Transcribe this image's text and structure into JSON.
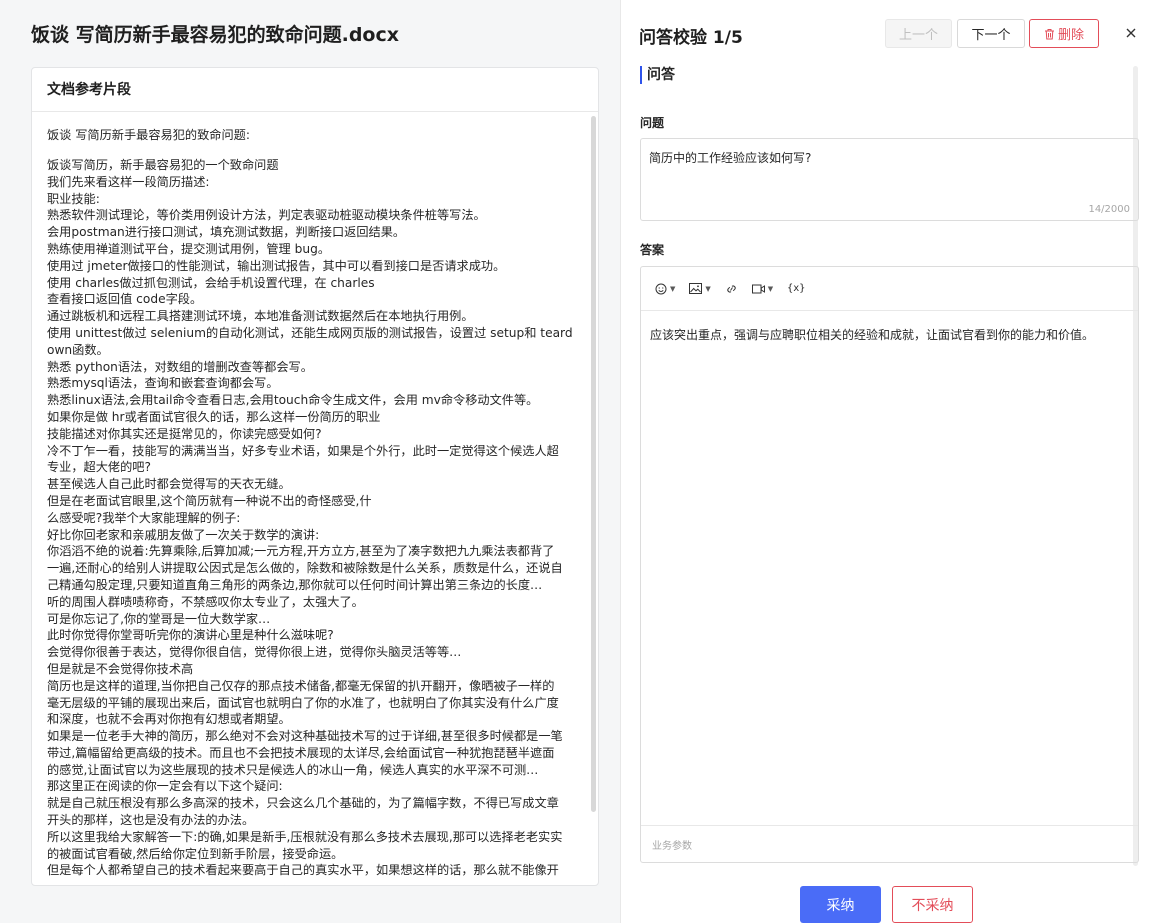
{
  "document": {
    "title": "饭谈 写简历新手最容易犯的致命问题.docx",
    "reference_header": "文档参考片段",
    "reference_first_line": "饭谈 写简历新手最容易犯的致命问题:",
    "reference_lines": [
      "饭谈写简历，新手最容易犯的一个致命问题",
      "我们先来看这样一段简历描述:",
      "职业技能:",
      "熟悉软件测试理论，等价类用例设计方法，判定表驱动桩驱动模块条件桩等写法。",
      "会用postman进行接口测试，填充测试数据，判断接口返回结果。",
      "熟练使用禅道测试平台，提交测试用例，管理 bug。",
      "使用过 jmeter做接口的性能测试，输出测试报告，其中可以看到接口是否请求成功。",
      "使用 charles做过抓包测试，会给手机设置代理，在 charles",
      "查看接口返回值 code字段。",
      "通过跳板机和远程工具搭建测试环境，本地准备测试数据然后在本地执行用例。",
      "使用 unittest做过 selenium的自动化测试，还能生成网页版的测试报告，设置过 setup和 teard",
      "own函数。",
      "熟悉 python语法，对数组的增删改查等都会写。",
      "熟悉mysql语法，查询和嵌套查询都会写。",
      "熟悉linux语法,会用tail命令查看日志,会用touch命令生成文件，会用 mv命令移动文件等。",
      "如果你是做 hr或者面试官很久的话，那么这样一份简历的职业",
      "技能描述对你其实还是挺常见的，你读完感受如何?",
      "冷不丁乍一看，技能写的满满当当，好多专业术语，如果是个外行，此时一定觉得这个候选人超",
      "专业，超大佬的吧?",
      "甚至候选人自己此时都会觉得写的天衣无缝。",
      "但是在老面试官眼里,这个简历就有一种说不出的奇怪感受,什",
      "么感受呢?我举个大家能理解的例子:",
      "好比你回老家和亲戚朋友做了一次关于数学的演讲:",
      "你滔滔不绝的说着:先算乘除,后算加减;一元方程,开方立方,甚至为了凑字数把九九乘法表都背了",
      "一遍,还耐心的给别人讲提取公因式是怎么做的，除数和被除数是什么关系，质数是什么，还说自",
      "己精通勾股定理,只要知道直角三角形的两条边,那你就可以任何时间计算出第三条边的长度…",
      "听的周围人群啧啧称奇，不禁感叹你太专业了，太强大了。",
      "可是你忘记了,你的堂哥是一位大数学家…",
      "此时你觉得你堂哥听完你的演讲心里是种什么滋味呢?",
      "会觉得你很善于表达，觉得你很自信，觉得你很上进，觉得你头脑灵活等等…",
      "但是就是不会觉得你技术高",
      "简历也是这样的道理,当你把自己仅存的那点技术储备,都毫无保留的扒开翻开，像晒被子一样的",
      "毫无层级的平铺的展现出来后，面试官也就明白了你的水准了，也就明白了你其实没有什么广度",
      "和深度，也就不会再对你抱有幻想或者期望。",
      "如果是一位老手大神的简历，那么绝对不会对这种基础技术写的过于详细,甚至很多时候都是一笔",
      "带过,篇幅留给更高级的技术。而且也不会把技术展现的太详尽,会给面试官一种犹抱琵琶半遮面",
      "的感觉,让面试官以为这些展现的技术只是候选人的冰山一角，候选人真实的水平深不可测…",
      "那这里正在阅读的你一定会有以下这个疑问:",
      "就是自己就压根没有那么多高深的技术，只会这么几个基础的，为了篇幅字数，不得已写成文章",
      "开头的那样，这也是没有办法的办法。",
      "所以这里我给大家解答一下:的确,如果是新手,压根就没有那么多技术去展现,那可以选择老老实实",
      "的被面试官看破,然后给你定位到新手阶层，接受命运。",
      "但是每个人都希望自己的技术看起来要高于自己的真实水平，如果想这样的话，那么就不能像开"
    ]
  },
  "qa": {
    "title": "问答校验 1/5",
    "prev_label": "上一个",
    "next_label": "下一个",
    "delete_label": "删除",
    "section_label": "问答",
    "question_label": "问题",
    "question_text": "简历中的工作经验应该如何写?",
    "question_counter": "14/2000",
    "answer_label": "答案",
    "answer_text": "应该突出重点，强调与应聘职位相关的经验和成就，让面试官看到你的能力和价值。",
    "toolbar_variable": "{x}",
    "biz_params": "业务参数",
    "accept_label": "采纳",
    "reject_label": "不采纳"
  },
  "colors": {
    "primary": "#4a6cf7",
    "danger": "#e34d59",
    "accent_bar": "#2f54eb"
  }
}
